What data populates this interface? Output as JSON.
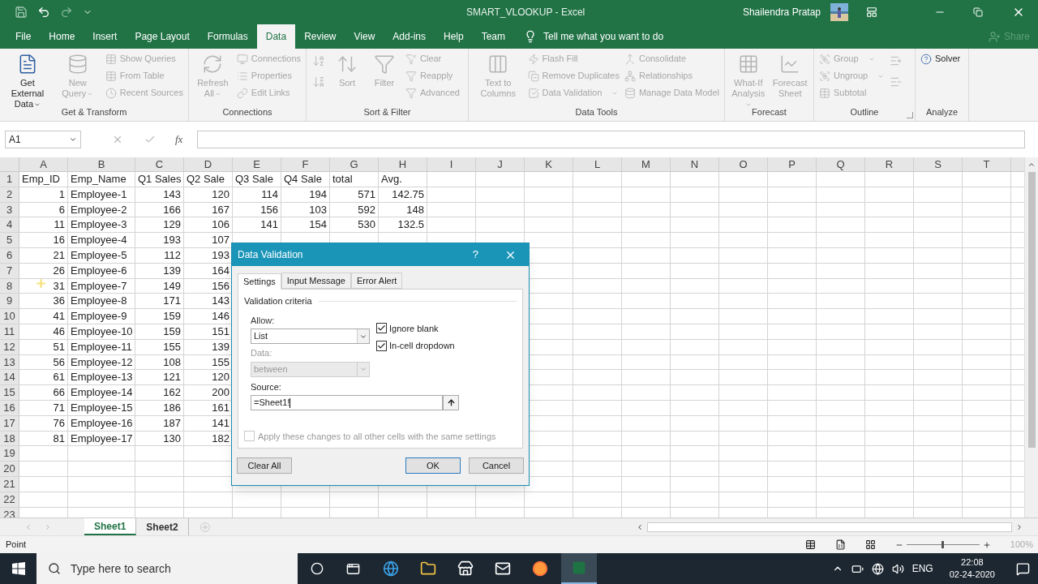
{
  "window": {
    "title": "SMART_VLOOKUP  -  Excel",
    "user": "Shailendra Pratap"
  },
  "menu_tabs": [
    {
      "label": "File",
      "selected": false
    },
    {
      "label": "Home",
      "selected": false
    },
    {
      "label": "Insert",
      "selected": false
    },
    {
      "label": "Page Layout",
      "selected": false
    },
    {
      "label": "Formulas",
      "selected": false
    },
    {
      "label": "Data",
      "selected": true
    },
    {
      "label": "Review",
      "selected": false
    },
    {
      "label": "View",
      "selected": false
    },
    {
      "label": "Add-ins",
      "selected": false
    },
    {
      "label": "Help",
      "selected": false
    },
    {
      "label": "Team",
      "selected": false
    }
  ],
  "tell_me": "Tell me what you want to do",
  "share": {
    "label": "Share",
    "disabled": true
  },
  "ribbon_groups": [
    {
      "label": "Get & Transform",
      "columns": [
        [
          {
            "kind": "large",
            "label": "Get External Data",
            "disabled": false,
            "dropdown": true
          }
        ],
        [
          {
            "kind": "large",
            "label": "New Query",
            "disabled": true,
            "dropdown": true
          }
        ],
        [
          {
            "kind": "small",
            "label": "Show Queries",
            "disabled": true
          },
          {
            "kind": "small",
            "label": "From Table",
            "disabled": true
          },
          {
            "kind": "small",
            "label": "Recent Sources",
            "disabled": true
          }
        ]
      ]
    },
    {
      "label": "Connections",
      "columns": [
        [
          {
            "kind": "large",
            "label": "Refresh All",
            "disabled": true,
            "dropdown": true
          }
        ],
        [
          {
            "kind": "small",
            "label": "Connections",
            "disabled": true
          },
          {
            "kind": "small",
            "label": "Properties",
            "disabled": true
          },
          {
            "kind": "small",
            "label": "Edit Links",
            "disabled": true
          }
        ]
      ]
    },
    {
      "label": "Sort & Filter",
      "columns": [
        [
          {
            "kind": "icon",
            "disabled": true
          },
          {
            "kind": "icon",
            "disabled": true
          }
        ],
        [
          {
            "kind": "large",
            "label": "Sort",
            "disabled": true
          }
        ],
        [
          {
            "kind": "large",
            "label": "Filter",
            "disabled": true
          }
        ],
        [
          {
            "kind": "small",
            "label": "Clear",
            "disabled": true
          },
          {
            "kind": "small",
            "label": "Reapply",
            "disabled": true
          },
          {
            "kind": "small",
            "label": "Advanced",
            "disabled": true
          }
        ]
      ]
    },
    {
      "label": "Data Tools",
      "columns": [
        [
          {
            "kind": "large",
            "label": "Text to Columns",
            "disabled": true
          }
        ],
        [
          {
            "kind": "small",
            "label": "Flash Fill",
            "disabled": true
          },
          {
            "kind": "small",
            "label": "Remove Duplicates",
            "disabled": true
          },
          {
            "kind": "small",
            "label": "Data Validation",
            "disabled": true,
            "dropdown": true
          }
        ],
        [
          {
            "kind": "small",
            "label": "Consolidate",
            "disabled": true
          },
          {
            "kind": "small",
            "label": "Relationships",
            "disabled": true
          },
          {
            "kind": "small",
            "label": "Manage Data Model",
            "disabled": true
          }
        ]
      ]
    },
    {
      "label": "Forecast",
      "columns": [
        [
          {
            "kind": "large",
            "label": "What-If Analysis",
            "disabled": true,
            "dropdown": true
          }
        ],
        [
          {
            "kind": "large",
            "label": "Forecast Sheet",
            "disabled": true
          }
        ]
      ]
    },
    {
      "label": "Outline",
      "launcher": true,
      "columns": [
        [
          {
            "kind": "small",
            "label": "Group",
            "disabled": true,
            "dropdown": true
          },
          {
            "kind": "small",
            "label": "Ungroup",
            "disabled": true,
            "dropdown": true
          },
          {
            "kind": "small",
            "label": "Subtotal",
            "disabled": true
          }
        ],
        [
          {
            "kind": "icon",
            "disabled": true
          },
          {
            "kind": "icon",
            "disabled": true
          }
        ]
      ]
    },
    {
      "label": "Analyze",
      "columns": [
        [
          {
            "kind": "small",
            "label": "Solver",
            "disabled": false
          }
        ]
      ]
    }
  ],
  "formula_bar": {
    "name_box": "A1",
    "function_label": "fx"
  },
  "columns": [
    {
      "letter": "A"
    },
    {
      "letter": "B"
    },
    {
      "letter": "C"
    },
    {
      "letter": "D"
    },
    {
      "letter": "E"
    },
    {
      "letter": "F"
    },
    {
      "letter": "G"
    },
    {
      "letter": "H"
    },
    {
      "letter": "I"
    },
    {
      "letter": "J"
    },
    {
      "letter": "K"
    },
    {
      "letter": "L"
    },
    {
      "letter": "M"
    },
    {
      "letter": "N"
    },
    {
      "letter": "O"
    },
    {
      "letter": "P"
    },
    {
      "letter": "Q"
    },
    {
      "letter": "R"
    },
    {
      "letter": "S"
    },
    {
      "letter": "T"
    }
  ],
  "rows": [
    {
      "number": "1",
      "kind": "text",
      "cells": [
        "Emp_ID",
        "Emp_Name",
        "Q1 Sales",
        "Q2 Sale",
        "Q3 Sale",
        "Q4 Sale",
        "total",
        "Avg."
      ]
    },
    {
      "number": "2",
      "kind": "numbers",
      "cells": [
        "1",
        "Employee-1",
        "143",
        "120",
        "114",
        "194",
        "571",
        "142.75"
      ]
    },
    {
      "number": "3",
      "kind": "numbers",
      "cells": [
        "6",
        "Employee-2",
        "166",
        "167",
        "156",
        "103",
        "592",
        "148"
      ]
    },
    {
      "number": "4",
      "kind": "numbers",
      "cells": [
        "11",
        "Employee-3",
        "129",
        "106",
        "141",
        "154",
        "530",
        "132.5"
      ]
    },
    {
      "number": "5",
      "kind": "numbers",
      "cells": [
        "16",
        "Employee-4",
        "193",
        "107"
      ]
    },
    {
      "number": "6",
      "kind": "numbers",
      "cells": [
        "21",
        "Employee-5",
        "112",
        "193"
      ]
    },
    {
      "number": "7",
      "kind": "numbers",
      "cells": [
        "26",
        "Employee-6",
        "139",
        "164"
      ]
    },
    {
      "number": "8",
      "kind": "numbers",
      "cells": [
        "31",
        "Employee-7",
        "149",
        "156"
      ]
    },
    {
      "number": "9",
      "kind": "numbers",
      "cells": [
        "36",
        "Employee-8",
        "171",
        "143"
      ]
    },
    {
      "number": "10",
      "kind": "numbers",
      "cells": [
        "41",
        "Employee-9",
        "159",
        "146"
      ]
    },
    {
      "number": "11",
      "kind": "numbers",
      "cells": [
        "46",
        "Employee-10",
        "159",
        "151"
      ]
    },
    {
      "number": "12",
      "kind": "numbers",
      "cells": [
        "51",
        "Employee-11",
        "155",
        "139"
      ]
    },
    {
      "number": "13",
      "kind": "numbers",
      "cells": [
        "56",
        "Employee-12",
        "108",
        "155"
      ]
    },
    {
      "number": "14",
      "kind": "numbers",
      "cells": [
        "61",
        "Employee-13",
        "121",
        "120"
      ]
    },
    {
      "number": "15",
      "kind": "numbers",
      "cells": [
        "66",
        "Employee-14",
        "162",
        "200"
      ]
    },
    {
      "number": "16",
      "kind": "numbers",
      "cells": [
        "71",
        "Employee-15",
        "186",
        "161"
      ]
    },
    {
      "number": "17",
      "kind": "numbers",
      "cells": [
        "76",
        "Employee-16",
        "187",
        "141"
      ]
    },
    {
      "number": "18",
      "kind": "numbers",
      "cells": [
        "81",
        "Employee-17",
        "130",
        "182"
      ]
    },
    {
      "number": "19",
      "cells": []
    },
    {
      "number": "20",
      "cells": []
    },
    {
      "number": "21",
      "cells": []
    },
    {
      "number": "22",
      "cells": []
    },
    {
      "number": "23",
      "cells": []
    }
  ],
  "sheet_tabs": [
    {
      "label": "Sheet1",
      "selected": true
    },
    {
      "label": "Sheet2",
      "selected": false
    }
  ],
  "status_bar": {
    "mode": "Point",
    "zoom": "100%",
    "zoom_slider": {
      "level": 0.5
    }
  },
  "dialog": {
    "title": "Data Validation",
    "help": "?",
    "tabs": [
      {
        "label": "Settings",
        "selected": true
      },
      {
        "label": "Input Message",
        "selected": false
      },
      {
        "label": "Error Alert",
        "selected": false
      }
    ],
    "section": "Validation criteria",
    "allow": {
      "label": "Allow:",
      "value": "List",
      "disabled": false
    },
    "data": {
      "label": "Data:",
      "value": "between",
      "disabled": true
    },
    "checkboxes": [
      {
        "label": "Ignore blank",
        "checked": true
      },
      {
        "label": "In-cell dropdown",
        "checked": true
      }
    ],
    "source": {
      "label": "Source:",
      "value": "=Sheet1!"
    },
    "apply_all": {
      "label": "Apply these changes to all other cells with the same settings",
      "checked": false,
      "disabled": true
    },
    "buttons": [
      {
        "label": "Clear All",
        "kind": "left"
      },
      {
        "label": "OK",
        "kind": "default"
      },
      {
        "label": "Cancel",
        "kind": "normal"
      }
    ]
  },
  "taskbar": {
    "search_placeholder": "Type here to search",
    "language": "ENG",
    "time": "22:08",
    "date": "02-24-2020"
  }
}
